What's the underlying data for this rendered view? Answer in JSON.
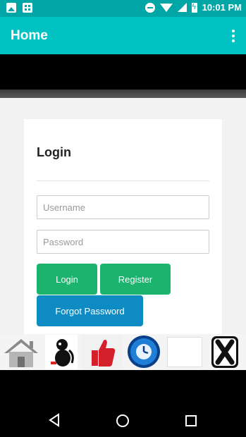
{
  "status_bar": {
    "time": "10:01",
    "time_suffix": "PM",
    "icons": [
      "photo-icon",
      "grid-app-icon",
      "do-not-disturb-icon",
      "wifi-icon",
      "signal-icon",
      "battery-charging-icon"
    ]
  },
  "app_bar": {
    "title": "Home",
    "overflow_icon": "more-vert-icon"
  },
  "login_card": {
    "heading": "Login",
    "username_placeholder": "Username",
    "password_placeholder": "Password",
    "login_label": "Login",
    "register_label": "Register",
    "forgot_label": "Forgot Password"
  },
  "ad_banner": {
    "items": [
      "house-icon",
      "dog-app-icon",
      "thumbs-up-icon",
      "clock-icon",
      "blank-tile",
      "close-x-icon"
    ]
  },
  "colors": {
    "status_bar": "#00a6a6",
    "app_bar": "#00c2c2",
    "green_button": "#1bb36e",
    "blue_button": "#0d8bc2"
  },
  "nav_bar": {
    "buttons": [
      "back-triangle-icon",
      "home-circle-icon",
      "recent-square-icon"
    ]
  }
}
